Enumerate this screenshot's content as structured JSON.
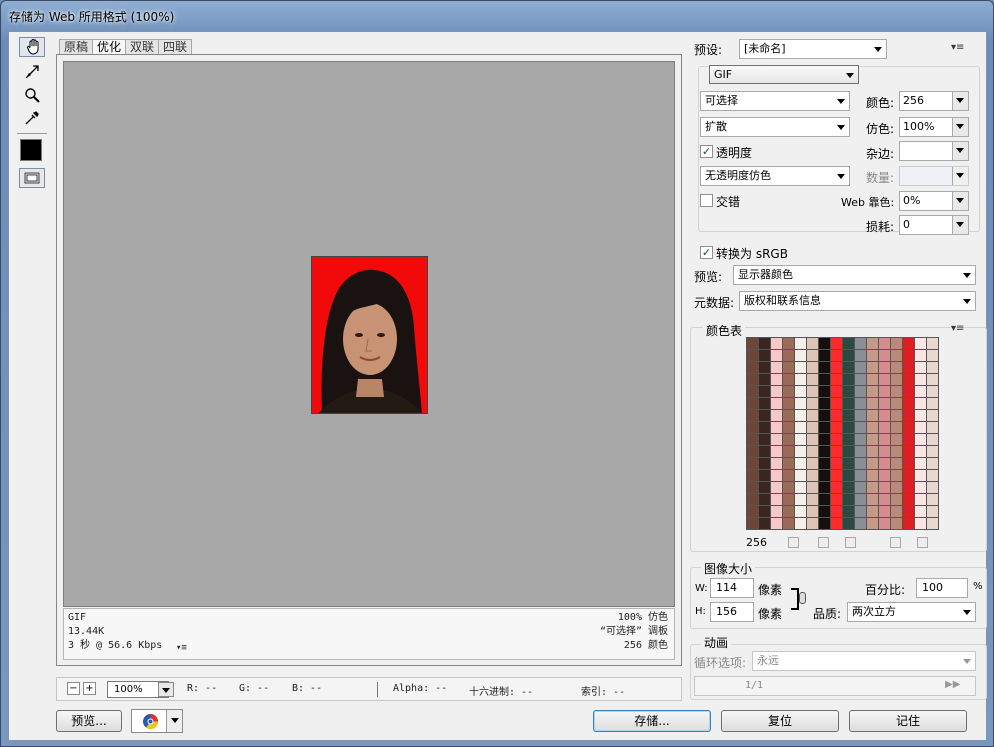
{
  "window": {
    "title": "存储为 Web 所用格式 (100%)"
  },
  "tabs": [
    "原稿",
    "优化",
    "双联",
    "四联"
  ],
  "active_tab": 1,
  "info": {
    "format": "GIF",
    "size": "13.44K",
    "time": "3 秒 @ 56.6 Kbps",
    "dither": "100% 仿色",
    "palette": "“可选择” 调板",
    "colors": "256 颜色"
  },
  "status": {
    "zoom": "100%",
    "r": "R: --",
    "g": "G: --",
    "b": "B: --",
    "alpha": "Alpha: --",
    "hex": "十六进制: --",
    "index": "索引: --"
  },
  "buttons": {
    "preview": "预览...",
    "save": "存储...",
    "reset": "复位",
    "remember": "记住"
  },
  "settings": {
    "preset_label": "预设:",
    "preset_value": "[未命名]",
    "format": "GIF",
    "reduction": "可选择",
    "dither_algo": "扩散",
    "colors_label": "颜色:",
    "colors_value": "256",
    "dither_label": "仿色:",
    "dither_value": "100%",
    "transparency_label": "透明度",
    "transparency_checked": true,
    "matte_label": "杂边:",
    "matte_value": "",
    "trans_dither": "无透明度仿色",
    "amount_label": "数量:",
    "amount_value": "",
    "interlaced_label": "交错",
    "interlaced_checked": false,
    "websnap_label": "Web 靠色:",
    "websnap_value": "0%",
    "lossy_label": "损耗:",
    "lossy_value": "0",
    "srgb_label": "转换为 sRGB",
    "srgb_checked": true,
    "preview_label": "预览:",
    "preview_value": "显示器颜色",
    "metadata_label": "元数据:",
    "metadata_value": "版权和联系信息"
  },
  "color_table": {
    "title": "颜色表",
    "count": "256"
  },
  "image_size": {
    "title": "图像大小",
    "w_label": "W:",
    "w_value": "114",
    "h_label": "H:",
    "h_value": "156",
    "unit": "像素",
    "percent_label": "百分比:",
    "percent_value": "100",
    "percent_unit": "%",
    "quality_label": "品质:",
    "quality_value": "两次立方"
  },
  "animation": {
    "title": "动画",
    "loop_label": "循环选项:",
    "loop_value": "永远",
    "frame": "1/1"
  },
  "colors": {
    "accent": "#3c7fb1",
    "photo_bg": "#f20a0a",
    "canvas": "#a8a8a8"
  }
}
